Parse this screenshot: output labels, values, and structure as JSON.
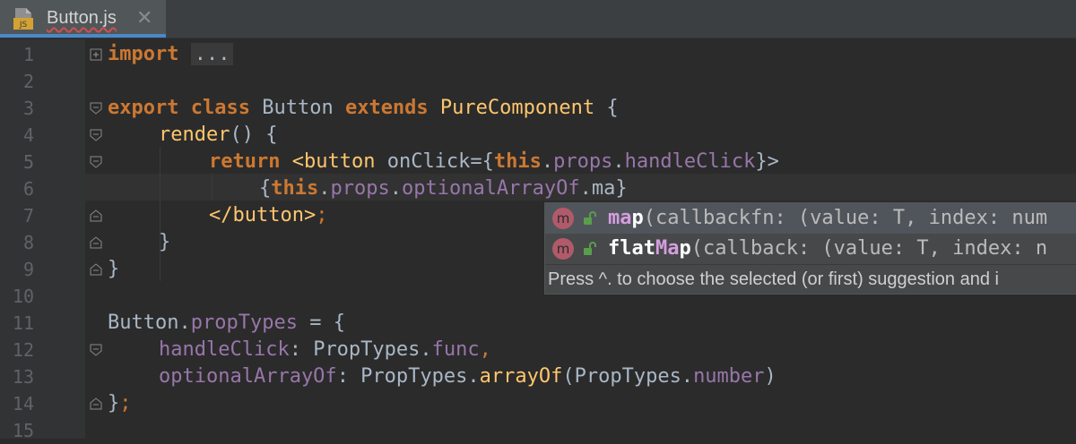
{
  "tab": {
    "icon_label": "JS",
    "title": "Button.js",
    "close_glyph": "✕"
  },
  "line_numbers": [
    "1",
    "2",
    "3",
    "4",
    "5",
    "6",
    "7",
    "8",
    "9",
    "10",
    "11",
    "12",
    "13",
    "14",
    "15"
  ],
  "code": {
    "l1_kw": "import",
    "l1_fold": "...",
    "l4_export": "export",
    "l4_class": "class",
    "l4_name": "Button",
    "l4_extends": "extends",
    "l4_super": "PureComponent",
    "l4_brace": "{",
    "l5_fn": "render",
    "l5_rest": "() {",
    "l6_return": "return",
    "l6_tag": "<button",
    "l6_attr": "onClick",
    "l6_eq": "={",
    "l6_this": "this",
    "l6_dot1": ".",
    "l6_props": "props",
    "l6_dot2": ".",
    "l6_handler": "handleClick",
    "l6_close": "}>",
    "l7_open": "{",
    "l7_this": "this",
    "l7_dot1": ".",
    "l7_props": "props",
    "l7_dot2": ".",
    "l7_arr": "optionalArrayOf",
    "l7_tail": ".ma}",
    "l8_tag": "</button>",
    "l8_semi": ";",
    "l9": "}",
    "l10": "}",
    "l12_obj": "Button",
    "l12_dot": ".",
    "l12_prop": "propTypes",
    "l12_rest": " = {",
    "l13_key": "handleClick",
    "l13_colon": ": PropTypes.",
    "l13_val": "func",
    "l13_comma": ",",
    "l14_key": "optionalArrayOf",
    "l14_colon": ": PropTypes.",
    "l14_fn": "arrayOf",
    "l14_arg": "(PropTypes.",
    "l14_num": "number",
    "l14_end": ")",
    "l15_brace": "}",
    "l15_semi": ";"
  },
  "autocomplete": {
    "items": [
      {
        "kind": "m",
        "match": "ma",
        "rest": "p",
        "signature": "(callbackfn: (value: T, index: num"
      },
      {
        "kind": "m",
        "prefix": "flat",
        "match": "Ma",
        "rest": "p",
        "signature": "(callback: (value: T, index: n"
      }
    ],
    "hint": "Press ^. to choose the selected (or first) suggestion and i"
  },
  "colors": {
    "background": "#2b2b2b",
    "keyword": "#cc7832",
    "function": "#ffc66d",
    "property": "#9876aa",
    "text": "#a9b7c6",
    "accent_tab": "#4a88c7"
  }
}
